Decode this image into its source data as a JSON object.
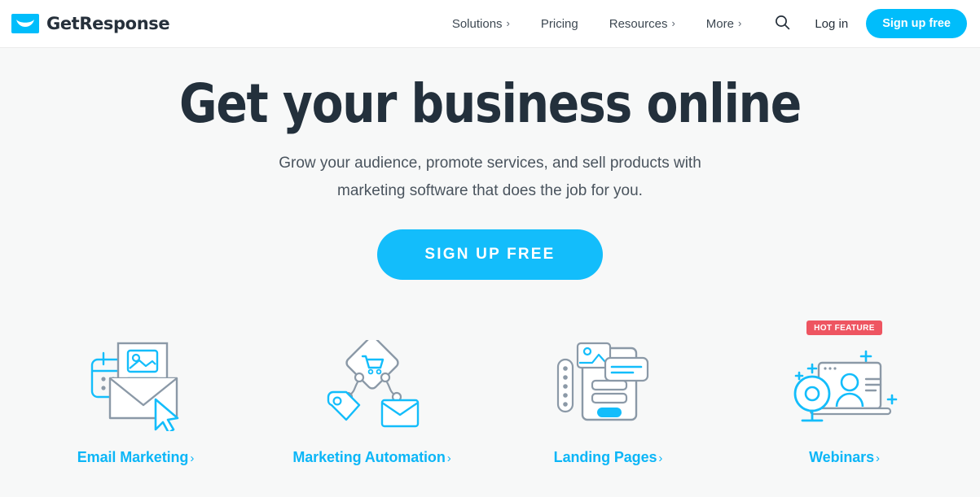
{
  "header": {
    "brand_name": "GetResponse",
    "brand_icon": "envelope-logo-icon",
    "nav": [
      {
        "label": "Solutions",
        "caret": "›",
        "has_caret": true
      },
      {
        "label": "Pricing",
        "caret": "",
        "has_caret": false
      },
      {
        "label": "Resources",
        "caret": "›",
        "has_caret": true
      },
      {
        "label": "More",
        "caret": "›",
        "has_caret": true
      }
    ],
    "search_icon": "search-icon",
    "login_label": "Log in",
    "signup_label": "Sign up free"
  },
  "hero": {
    "title": "Get your business online",
    "subtitle_line1": "Grow your audience, promote services, and sell products with",
    "subtitle_line2": "marketing software that does the job for you.",
    "cta_label": "SIGN UP FREE"
  },
  "features": [
    {
      "label": "Email Marketing",
      "chevron": "›",
      "icon": "email-marketing-icon",
      "badge": ""
    },
    {
      "label": "Marketing Automation",
      "chevron": "›",
      "icon": "marketing-automation-icon",
      "badge": ""
    },
    {
      "label": "Landing Pages",
      "chevron": "›",
      "icon": "landing-pages-icon",
      "badge": ""
    },
    {
      "label": "Webinars",
      "chevron": "›",
      "icon": "webinars-icon",
      "badge": "HOT FEATURE"
    }
  ],
  "colors": {
    "brand_cyan": "#00bdfb",
    "cta_cyan": "#13bdfb",
    "link_cyan": "#0cb6f7",
    "badge_red": "#ee5561",
    "heading_dark": "#23303c",
    "icon_gray": "#8b99a7",
    "page_bg": "#f7f8f8"
  }
}
